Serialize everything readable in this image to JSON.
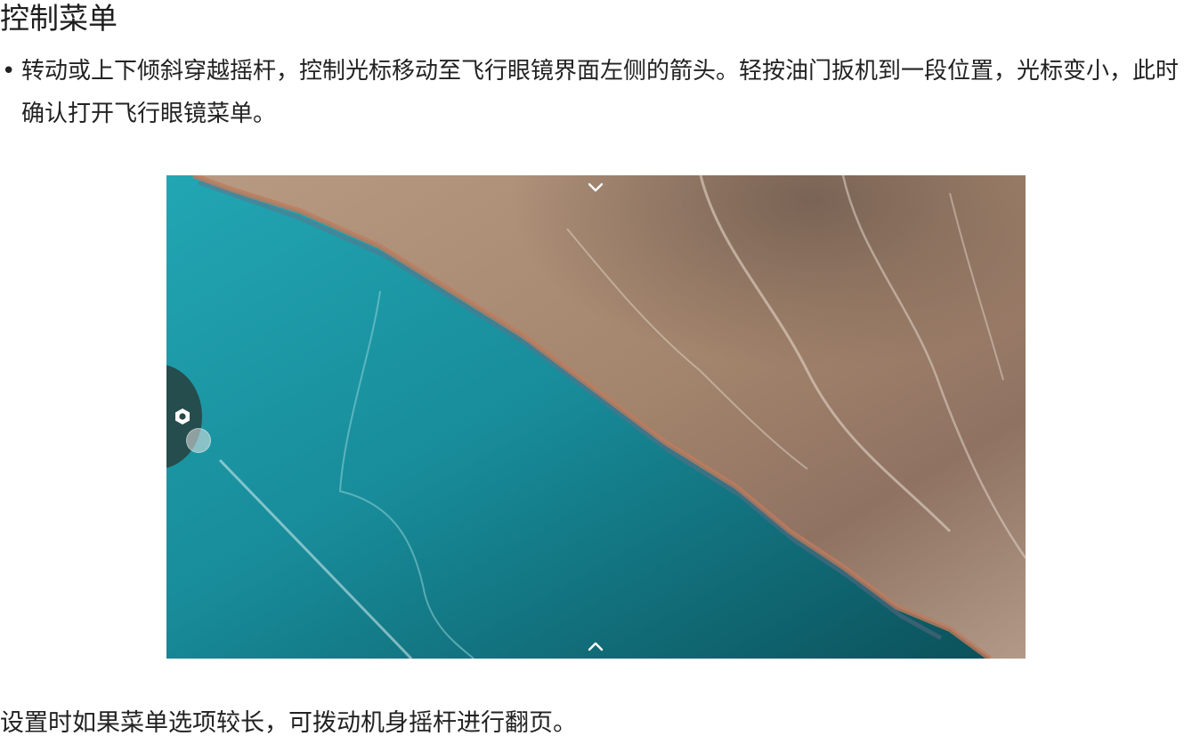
{
  "heading": "控制菜单",
  "bullets": [
    {
      "marker": "•",
      "text": "转动或上下倾斜穿越摇杆，控制光标移动至飞行眼镜界面左侧的箭头。轻按油门扳机到一段位置，光标变小，此时确认打开飞行眼镜菜单。"
    }
  ],
  "figure": {
    "top_arrow_icon": "chevron-down-icon",
    "bottom_arrow_icon": "chevron-up-icon",
    "menu_icon": "gear-icon",
    "colors": {
      "water": "#1a98a6",
      "deep_water": "#0e5a63",
      "land": "#a88a72",
      "menu_tab": "#274646"
    }
  },
  "footer": "设置时如果菜单选项较长，可拨动机身摇杆进行翻页。"
}
